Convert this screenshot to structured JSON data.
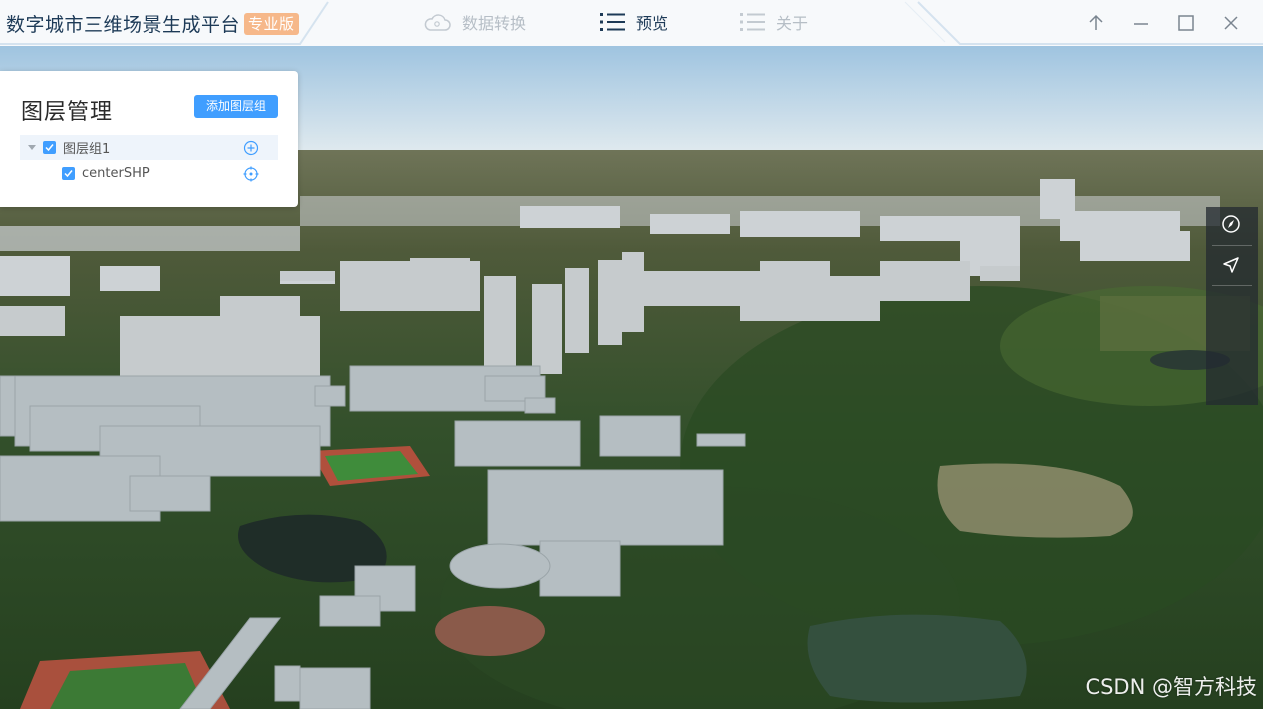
{
  "app": {
    "title": "数字城市三维场景生成平台",
    "badge": "专业版",
    "badge_color": "#f6b88a"
  },
  "nav": {
    "tabs": [
      {
        "label": "数据转换",
        "icon": "cloud-icon",
        "active": false
      },
      {
        "label": "预览",
        "icon": "list-icon",
        "active": true
      },
      {
        "label": "关于",
        "icon": "list-icon",
        "active": false
      }
    ]
  },
  "window_controls": [
    "pin-up-icon",
    "minimize-icon",
    "maximize-icon",
    "close-icon"
  ],
  "layer_panel": {
    "title": "图层管理",
    "add_group_label": "添加图层组",
    "accent_color": "#409eff",
    "tree": [
      {
        "label": "图层组1",
        "checked": true,
        "expanded": true,
        "icon": "add-circle-icon"
      },
      {
        "label": "centerSHP",
        "checked": true,
        "icon": "locate-icon"
      }
    ]
  },
  "map_tools": [
    "compass-icon",
    "navigate-icon"
  ],
  "watermark": "CSDN @智方科技"
}
